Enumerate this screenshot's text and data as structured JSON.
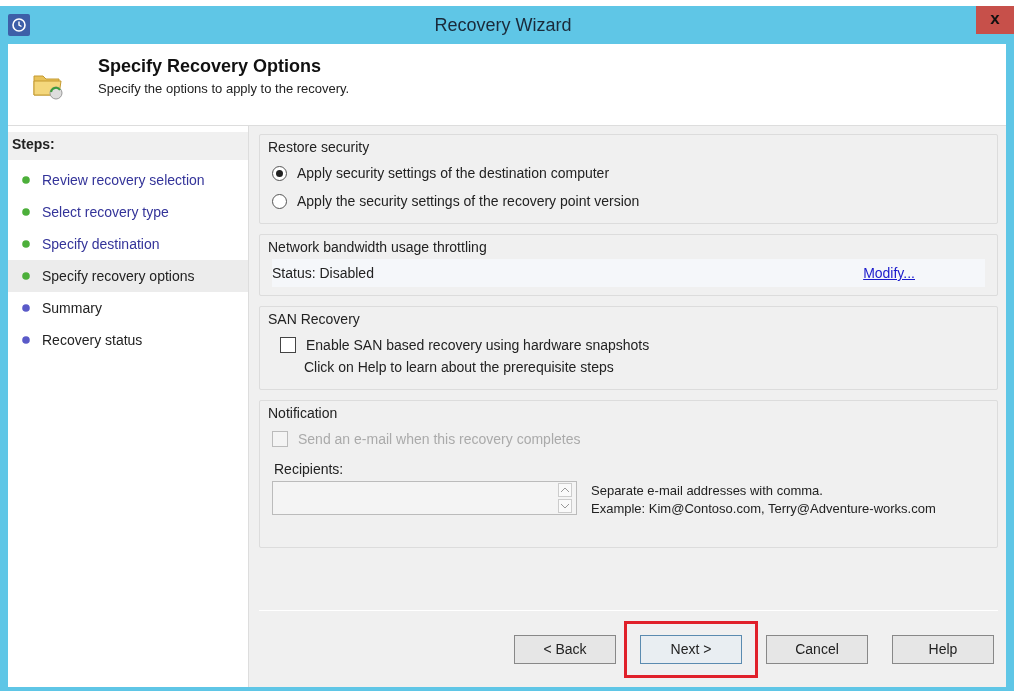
{
  "window": {
    "title": "Recovery Wizard",
    "close": "x"
  },
  "header": {
    "title": "Specify Recovery Options",
    "subtitle": "Specify the options to apply to the recovery."
  },
  "sidebar": {
    "heading": "Steps:",
    "items": [
      {
        "label": "Review recovery selection",
        "completed": true,
        "selected": false
      },
      {
        "label": "Select recovery type",
        "completed": true,
        "selected": false
      },
      {
        "label": "Specify destination",
        "completed": true,
        "selected": false
      },
      {
        "label": "Specify recovery options",
        "completed": true,
        "selected": true
      },
      {
        "label": "Summary",
        "completed": false,
        "selected": false
      },
      {
        "label": "Recovery status",
        "completed": false,
        "selected": false
      }
    ]
  },
  "sections": [
    {
      "kind": "radios",
      "title": "Restore security",
      "options": [
        {
          "label": "Apply security settings of the destination computer",
          "selected": true
        },
        {
          "label": "Apply the security settings of the recovery point version",
          "selected": false
        }
      ]
    },
    {
      "kind": "status",
      "title": "Network bandwidth usage throttling",
      "status": "Status: Disabled",
      "link": "Modify..."
    },
    {
      "kind": "checkbox",
      "title": "SAN Recovery",
      "checkbox": {
        "label": "Enable SAN based recovery using hardware snapshots",
        "checked": false,
        "disabled": false
      },
      "note": "Click on Help to learn about the prerequisite steps"
    },
    {
      "kind": "notification",
      "title": "Notification",
      "checkbox": {
        "label": "Send an e-mail when this recovery completes",
        "checked": false,
        "disabled": true
      },
      "recipients_label": "Recipients:",
      "hint_lines": [
        "Separate e-mail addresses with comma.",
        "Example: Kim@Contoso.com, Terry@Adventure-works.com"
      ]
    }
  ],
  "buttons": [
    {
      "label": "< Back",
      "highlighted": false
    },
    {
      "label": "Next >",
      "highlighted": true
    },
    {
      "label": "Cancel",
      "highlighted": false
    },
    {
      "label": "Help",
      "highlighted": false
    }
  ]
}
